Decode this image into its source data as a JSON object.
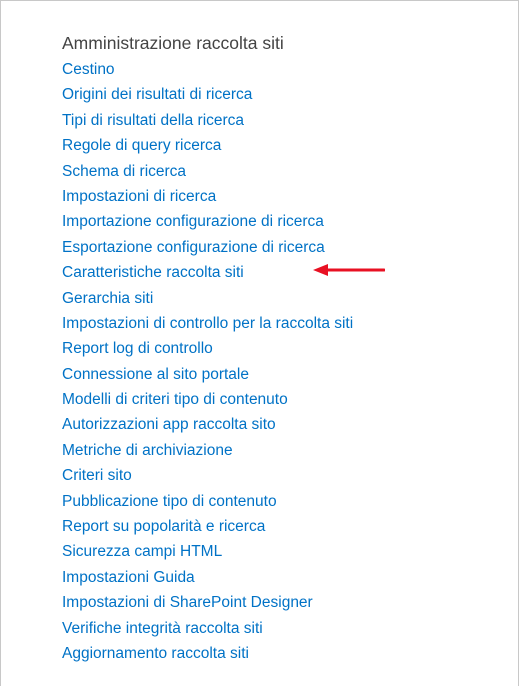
{
  "section": {
    "title": "Amministrazione raccolta siti",
    "links": [
      "Cestino",
      "Origini dei risultati di ricerca",
      "Tipi di risultati della ricerca",
      "Regole di query ricerca",
      "Schema di ricerca",
      "Impostazioni di ricerca",
      "Importazione configurazione di ricerca",
      "Esportazione configurazione di ricerca",
      "Caratteristiche raccolta siti",
      "Gerarchia siti",
      "Impostazioni di controllo per la raccolta siti",
      "Report log di controllo",
      "Connessione al sito portale",
      "Modelli di criteri tipo di contenuto",
      "Autorizzazioni app raccolta sito",
      "Metriche di archiviazione",
      "Criteri sito",
      "Pubblicazione tipo di contenuto",
      "Report su popolarità e ricerca",
      "Sicurezza campi HTML",
      "Impostazioni Guida",
      "Impostazioni di SharePoint Designer",
      "Verifiche integrità raccolta siti",
      "Aggiornamento raccolta siti"
    ]
  },
  "colors": {
    "link": "#0072c6",
    "heading": "#444444",
    "annotation_arrow": "#e81123"
  },
  "icons": {
    "annotation": "red-arrow-left-icon"
  }
}
